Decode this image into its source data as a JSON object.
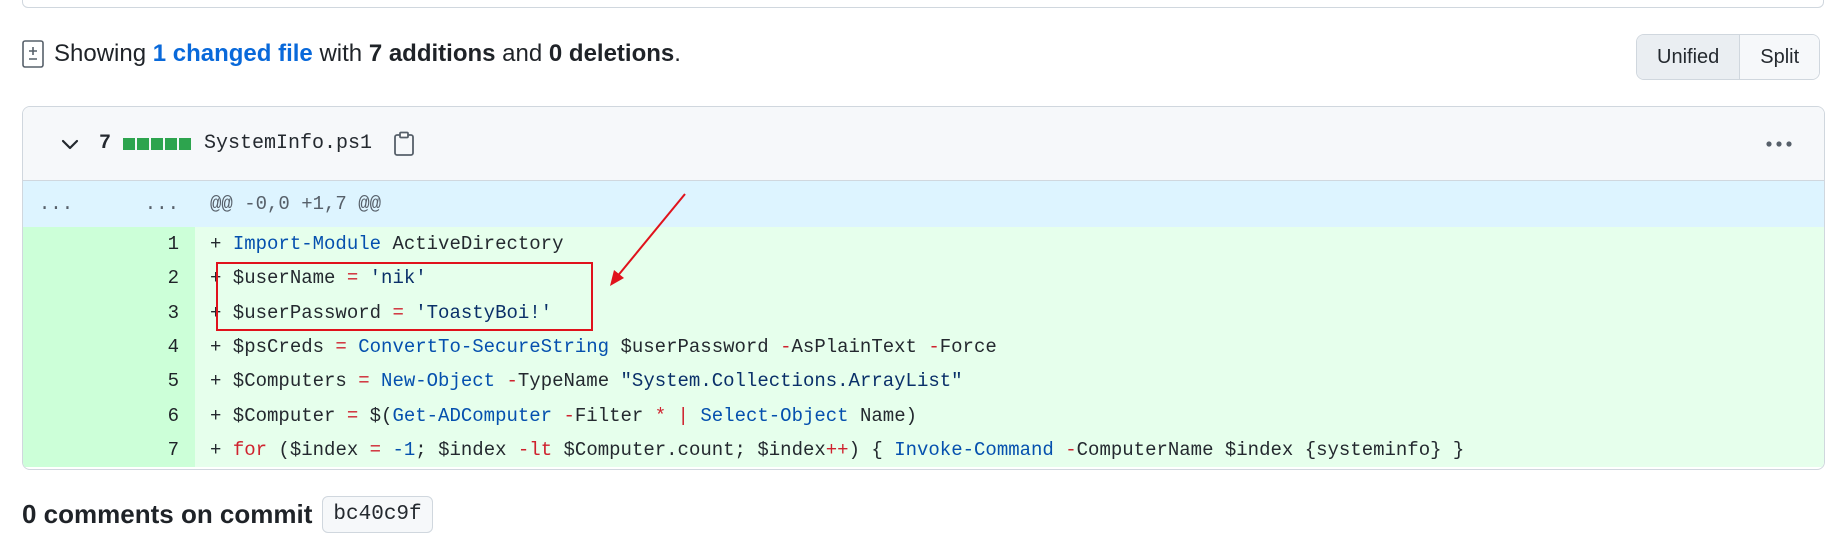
{
  "summary": {
    "showing": "Showing",
    "changed_files": "1 changed file",
    "with": "with",
    "additions": "7 additions",
    "and": "and",
    "deletions": "0 deletions",
    "period": "."
  },
  "view_toggle": {
    "unified": "Unified",
    "split": "Split",
    "selected": "Unified"
  },
  "file": {
    "additions_count": "7",
    "name": "SystemInfo.ps1",
    "diffstat_blocks": 5
  },
  "hunk": {
    "old_marker": "...",
    "new_marker": "...",
    "header": "@@ -0,0 +1,7 @@"
  },
  "lines": [
    {
      "num": "1",
      "tokens": [
        [
          "p",
          "+ "
        ],
        [
          "kw",
          "Import-Module"
        ],
        [
          "p",
          " ActiveDirectory"
        ]
      ]
    },
    {
      "num": "2",
      "tokens": [
        [
          "p",
          "+ $userName "
        ],
        [
          "op",
          "="
        ],
        [
          "p",
          " "
        ],
        [
          "str",
          "'nik'"
        ]
      ]
    },
    {
      "num": "3",
      "tokens": [
        [
          "p",
          "+ $userPassword "
        ],
        [
          "op",
          "="
        ],
        [
          "p",
          " "
        ],
        [
          "str",
          "'ToastyBoi!'"
        ]
      ]
    },
    {
      "num": "4",
      "tokens": [
        [
          "p",
          "+ $psCreds "
        ],
        [
          "op",
          "="
        ],
        [
          "p",
          " "
        ],
        [
          "kw",
          "ConvertTo-SecureString"
        ],
        [
          "p",
          " $userPassword "
        ],
        [
          "op",
          "-"
        ],
        [
          "p",
          "AsPlainText "
        ],
        [
          "op",
          "-"
        ],
        [
          "p",
          "Force"
        ]
      ]
    },
    {
      "num": "5",
      "tokens": [
        [
          "p",
          "+ $Computers "
        ],
        [
          "op",
          "="
        ],
        [
          "p",
          " "
        ],
        [
          "kw",
          "New-Object"
        ],
        [
          "p",
          " "
        ],
        [
          "op",
          "-"
        ],
        [
          "p",
          "TypeName "
        ],
        [
          "str",
          "\"System.Collections.ArrayList\""
        ]
      ]
    },
    {
      "num": "6",
      "tokens": [
        [
          "p",
          "+ $Computer "
        ],
        [
          "op",
          "="
        ],
        [
          "p",
          " $("
        ],
        [
          "kw",
          "Get-ADComputer"
        ],
        [
          "p",
          " "
        ],
        [
          "op",
          "-"
        ],
        [
          "p",
          "Filter "
        ],
        [
          "op",
          "*"
        ],
        [
          "p",
          " "
        ],
        [
          "op",
          "|"
        ],
        [
          "p",
          " "
        ],
        [
          "kw",
          "Select-Object"
        ],
        [
          "p",
          " Name)"
        ]
      ]
    },
    {
      "num": "7",
      "tokens": [
        [
          "p",
          "+ "
        ],
        [
          "op",
          "for"
        ],
        [
          "p",
          " ($index "
        ],
        [
          "op",
          "="
        ],
        [
          "p",
          " "
        ],
        [
          "kw",
          "-1"
        ],
        [
          "p",
          "; $index "
        ],
        [
          "op",
          "-lt"
        ],
        [
          "p",
          " $Computer.count; $index"
        ],
        [
          "op",
          "++"
        ],
        [
          "p",
          ") { "
        ],
        [
          "kw",
          "Invoke-Command"
        ],
        [
          "p",
          " "
        ],
        [
          "op",
          "-"
        ],
        [
          "p",
          "ComputerName $index {systeminfo} }"
        ]
      ]
    }
  ],
  "comments": {
    "label": "0 comments on commit",
    "sha": "bc40c9f"
  },
  "colors": {
    "link": "#0969da",
    "addition_bg": "#e6ffec",
    "addition_gutter": "#ccffd8",
    "hunk_bg": "#ddf4ff",
    "diffstat_green": "#2da44e",
    "annotation_red": "#e0121c"
  },
  "icons": [
    "diff-file-icon",
    "chevron-down-icon",
    "copy-clipboard-icon",
    "kebab-horizontal-icon"
  ]
}
